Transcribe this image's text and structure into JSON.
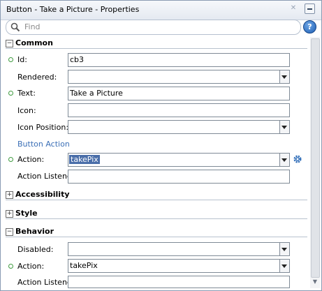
{
  "window": {
    "title": "Button - Take a Picture - Properties"
  },
  "find": {
    "placeholder": "Find"
  },
  "sections": {
    "common": "Common",
    "accessibility": "Accessibility",
    "style": "Style",
    "behavior": "Behavior"
  },
  "common": {
    "id_label": "Id:",
    "id_value": "cb3",
    "rendered_label": "Rendered:",
    "rendered_value": "",
    "text_label": "Text:",
    "text_value": "Take a Picture",
    "icon_label": "Icon:",
    "icon_value": "",
    "iconpos_label": "Icon Position:",
    "iconpos_value": ""
  },
  "button_action": {
    "heading": "Button Action",
    "action_label": "Action:",
    "action_value": "takePix",
    "listener_label": "Action Listener:",
    "listener_value": ""
  },
  "behavior": {
    "disabled_label": "Disabled:",
    "disabled_value": "",
    "action_label": "Action:",
    "action_value": "takePix",
    "listener_label": "Action Listener:",
    "listener_value": ""
  },
  "icons": {
    "help": "?"
  },
  "colors": {
    "required_dot": "#3f9b3f",
    "selection": "#4a6ea9",
    "subheading": "#3b6fb6"
  }
}
